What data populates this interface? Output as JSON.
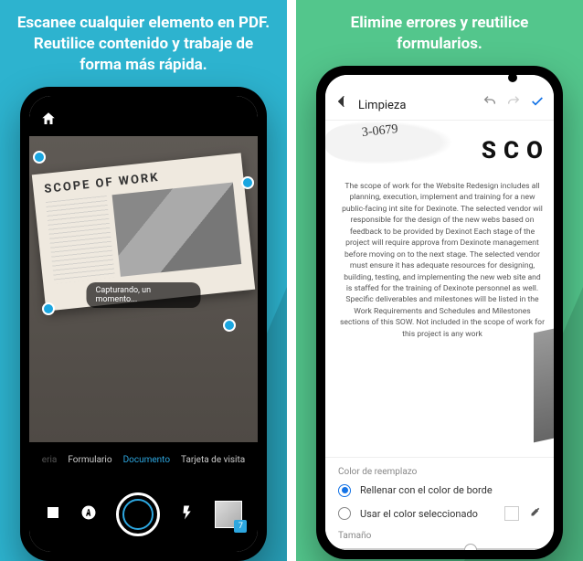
{
  "left": {
    "headline": "Escanee cualquier elemento en PDF. Reutilice contenido y trabaje de forma más rápida.",
    "doc_title": "SCOPE OF WORK",
    "toast": "Capturando, un momento...",
    "modes": {
      "prev": "eria",
      "form": "Formulario",
      "doc": "Documento",
      "card": "Tarjeta de visita"
    },
    "badge": "7"
  },
  "right": {
    "headline": "Elimine errores y reutilice formularios.",
    "title_bar": "Limpieza",
    "handwriting": "3-0679",
    "big_text": "SCO",
    "paragraph": "The scope of work for the Website Redesign includes all planning, execution, implement and training for a new public-facing int site for Dexinote. The selected vendor wil responsible for the design of the new webs based on feedback to be provided by Dexinot Each stage of the project will require approva from Dexinote management before moving on to the next stage. The selected vendor must ensure it has adequate resources for designing, building, testing, and implementing the new web site and is staffed for the training of Dexinote personnel as well. Specific deliverables and milestones will be listed in the Work Requirements and Schedules and Milestones sections of this SOW. Not included in the scope of work for this project is any work",
    "options": {
      "section": "Color de reemplazo",
      "opt1": "Rellenar con el color de borde",
      "opt2": "Usar el color seleccionado",
      "size": "Tamaño"
    }
  }
}
